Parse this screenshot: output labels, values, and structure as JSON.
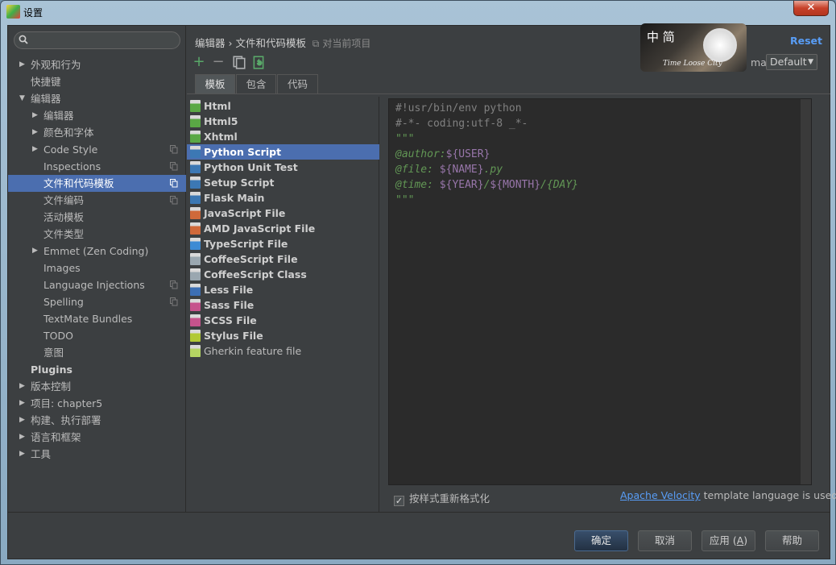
{
  "window": {
    "title": "设置",
    "close_glyph": "✕"
  },
  "search": {
    "placeholder": ""
  },
  "sidebar": {
    "items": [
      {
        "label": "外观和行为",
        "level": 0,
        "arrow": "▶",
        "bold": false,
        "copy": false
      },
      {
        "label": "快捷键",
        "level": 0,
        "arrow": "",
        "bold": false,
        "copy": false
      },
      {
        "label": "编辑器",
        "level": 0,
        "arrow": "▼",
        "bold": false,
        "copy": false
      },
      {
        "label": "编辑器",
        "level": 1,
        "arrow": "▶",
        "bold": false,
        "copy": false
      },
      {
        "label": "颜色和字体",
        "level": 1,
        "arrow": "▶",
        "bold": false,
        "copy": false
      },
      {
        "label": "Code Style",
        "level": 1,
        "arrow": "▶",
        "bold": false,
        "copy": true
      },
      {
        "label": "Inspections",
        "level": 1,
        "arrow": "",
        "bold": false,
        "copy": true
      },
      {
        "label": "文件和代码模板",
        "level": 1,
        "arrow": "",
        "bold": false,
        "copy": true,
        "selected": true
      },
      {
        "label": "文件编码",
        "level": 1,
        "arrow": "",
        "bold": false,
        "copy": true
      },
      {
        "label": "活动模板",
        "level": 1,
        "arrow": "",
        "bold": false,
        "copy": false
      },
      {
        "label": "文件类型",
        "level": 1,
        "arrow": "",
        "bold": false,
        "copy": false
      },
      {
        "label": "Emmet (Zen Coding)",
        "level": 1,
        "arrow": "▶",
        "bold": false,
        "copy": false
      },
      {
        "label": "Images",
        "level": 1,
        "arrow": "",
        "bold": false,
        "copy": false
      },
      {
        "label": "Language Injections",
        "level": 1,
        "arrow": "",
        "bold": false,
        "copy": true
      },
      {
        "label": "Spelling",
        "level": 1,
        "arrow": "",
        "bold": false,
        "copy": true
      },
      {
        "label": "TextMate Bundles",
        "level": 1,
        "arrow": "",
        "bold": false,
        "copy": false
      },
      {
        "label": "TODO",
        "level": 1,
        "arrow": "",
        "bold": false,
        "copy": false
      },
      {
        "label": "意图",
        "level": 1,
        "arrow": "",
        "bold": false,
        "copy": false
      },
      {
        "label": "Plugins",
        "level": 0,
        "arrow": "",
        "bold": true,
        "copy": false
      },
      {
        "label": "版本控制",
        "level": 0,
        "arrow": "▶",
        "bold": false,
        "copy": false
      },
      {
        "label": "项目: chapter5",
        "level": 0,
        "arrow": "▶",
        "bold": false,
        "copy": false
      },
      {
        "label": "构建、执行部署",
        "level": 0,
        "arrow": "▶",
        "bold": false,
        "copy": false
      },
      {
        "label": "语言和框架",
        "level": 0,
        "arrow": "▶",
        "bold": false,
        "copy": false
      },
      {
        "label": "工具",
        "level": 0,
        "arrow": "▶",
        "bold": false,
        "copy": false
      }
    ]
  },
  "breadcrumb": {
    "part1": "编辑器",
    "sep": "›",
    "part2": "文件和代码模板",
    "note": "对当前项目"
  },
  "reset_label": "Reset",
  "toolbar": {
    "add": "+",
    "remove": "−"
  },
  "scheme": {
    "label_partial": "ma:",
    "value": "Default",
    "chevron": "▼"
  },
  "logo": {
    "text": "中 简",
    "script": "Time Loose City"
  },
  "tabs": [
    {
      "label": "模板",
      "active": true
    },
    {
      "label": "包含",
      "active": false
    },
    {
      "label": "代码",
      "active": false
    }
  ],
  "files": [
    {
      "label": "Html",
      "icon_color": "#5aa845",
      "plain": false
    },
    {
      "label": "Html5",
      "icon_color": "#5aa845",
      "plain": false
    },
    {
      "label": "Xhtml",
      "icon_color": "#5aa845",
      "plain": false
    },
    {
      "label": "Python Script",
      "icon_color": "#3c78b4",
      "plain": false,
      "selected": true
    },
    {
      "label": "Python Unit Test",
      "icon_color": "#3c78b4",
      "plain": false
    },
    {
      "label": "Setup Script",
      "icon_color": "#3c78b4",
      "plain": false
    },
    {
      "label": "Flask Main",
      "icon_color": "#3c78b4",
      "plain": false
    },
    {
      "label": "JavaScript File",
      "icon_color": "#d0693a",
      "plain": false
    },
    {
      "label": "AMD JavaScript File",
      "icon_color": "#d0693a",
      "plain": false
    },
    {
      "label": "TypeScript File",
      "icon_color": "#3d8bd4",
      "plain": false
    },
    {
      "label": "CoffeeScript File",
      "icon_color": "#9aa7b0",
      "plain": false
    },
    {
      "label": "CoffeeScript Class",
      "icon_color": "#9aa7b0",
      "plain": false
    },
    {
      "label": "Less File",
      "icon_color": "#3d6fb4",
      "plain": false
    },
    {
      "label": "Sass File",
      "icon_color": "#c6538c",
      "plain": false
    },
    {
      "label": "SCSS File",
      "icon_color": "#c6538c",
      "plain": false
    },
    {
      "label": "Stylus File",
      "icon_color": "#b1c935",
      "plain": false
    },
    {
      "label": "Gherkin feature file",
      "icon_color": "#b5d463",
      "plain": true
    }
  ],
  "code": {
    "line1": "#!usr/bin/env python",
    "line2": "#-*- coding:utf-8 _*-",
    "line3": "\"\"\"",
    "author_tag": "@author:",
    "author_var": "${USER}",
    "file_tag": "@file: ",
    "file_var": "${NAME}",
    "file_ext": ".py",
    "time_tag": "@time: ",
    "time_year": "${YEAR}",
    "time_slash": "/",
    "time_month": "${MONTH}",
    "time_day": "/{DAY}",
    "line7": "\"\"\""
  },
  "reformat_label": "按样式重新格式化",
  "velocity": {
    "link": "Apache Velocity",
    "text": " template language is used"
  },
  "buttons": {
    "ok": "确定",
    "cancel": "取消",
    "apply": "应用",
    "apply_key": "A",
    "help": "帮助"
  },
  "colors": {
    "selection": "#4b6eaf",
    "link": "#589df6",
    "background": "#3c3f41",
    "editor_bg": "#2b2b2b"
  }
}
